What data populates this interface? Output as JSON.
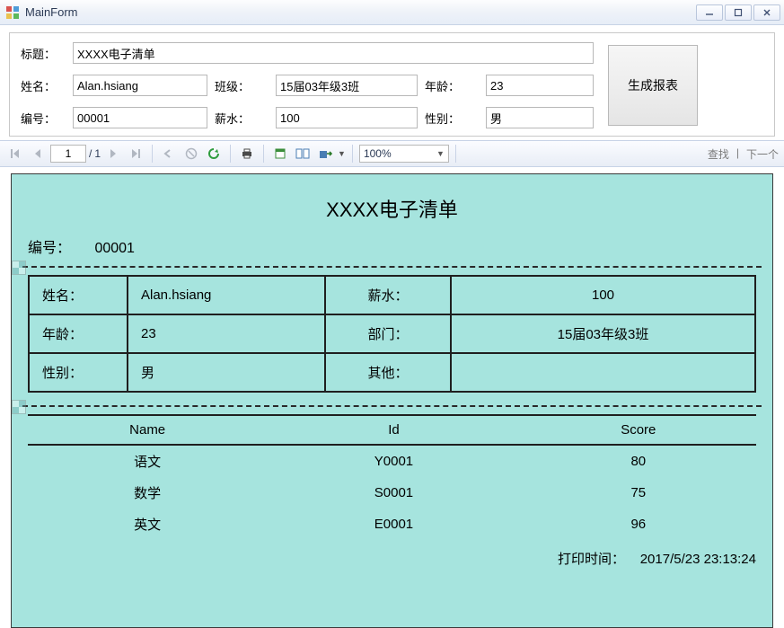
{
  "window": {
    "title": "MainForm"
  },
  "form": {
    "labels": {
      "title": "标题：",
      "name": "姓名：",
      "class": "班级：",
      "age": "年龄：",
      "id": "编号：",
      "salary": "薪水：",
      "gender": "性别："
    },
    "values": {
      "title": "XXXX电子清单",
      "name": "Alan.hsiang",
      "class": "15届03年级3班",
      "age": "23",
      "id": "00001",
      "salary": "100",
      "gender": "男"
    },
    "generate_label": "生成报表"
  },
  "toolbar": {
    "page_current": "1",
    "page_sep": "/",
    "page_total": "1",
    "zoom": "100%",
    "find": "查找",
    "find_sep": "|",
    "next": "下一个"
  },
  "report": {
    "title": "XXXX电子清单",
    "id_label": "编号：",
    "id_value": "00001",
    "info_rows": [
      {
        "l1": "姓名：",
        "v1": "Alan.hsiang",
        "l2": "薪水：",
        "v2": "100"
      },
      {
        "l1": "年龄：",
        "v1": "23",
        "l2": "部门：",
        "v2": "15届03年级3班"
      },
      {
        "l1": "性别：",
        "v1": "男",
        "l2": "其他：",
        "v2": ""
      }
    ],
    "score_headers": {
      "name": "Name",
      "id": "Id",
      "score": "Score"
    },
    "scores": [
      {
        "name": "语文",
        "id": "Y0001",
        "score": "80"
      },
      {
        "name": "数学",
        "id": "S0001",
        "score": "75"
      },
      {
        "name": "英文",
        "id": "E0001",
        "score": "96"
      }
    ],
    "print_label": "打印时间：",
    "print_time": "2017/5/23 23:13:24"
  },
  "chart_data": {
    "type": "table",
    "title": "XXXX电子清单",
    "columns": [
      "Name",
      "Id",
      "Score"
    ],
    "rows": [
      [
        "语文",
        "Y0001",
        80
      ],
      [
        "数学",
        "S0001",
        75
      ],
      [
        "英文",
        "E0001",
        96
      ]
    ]
  }
}
